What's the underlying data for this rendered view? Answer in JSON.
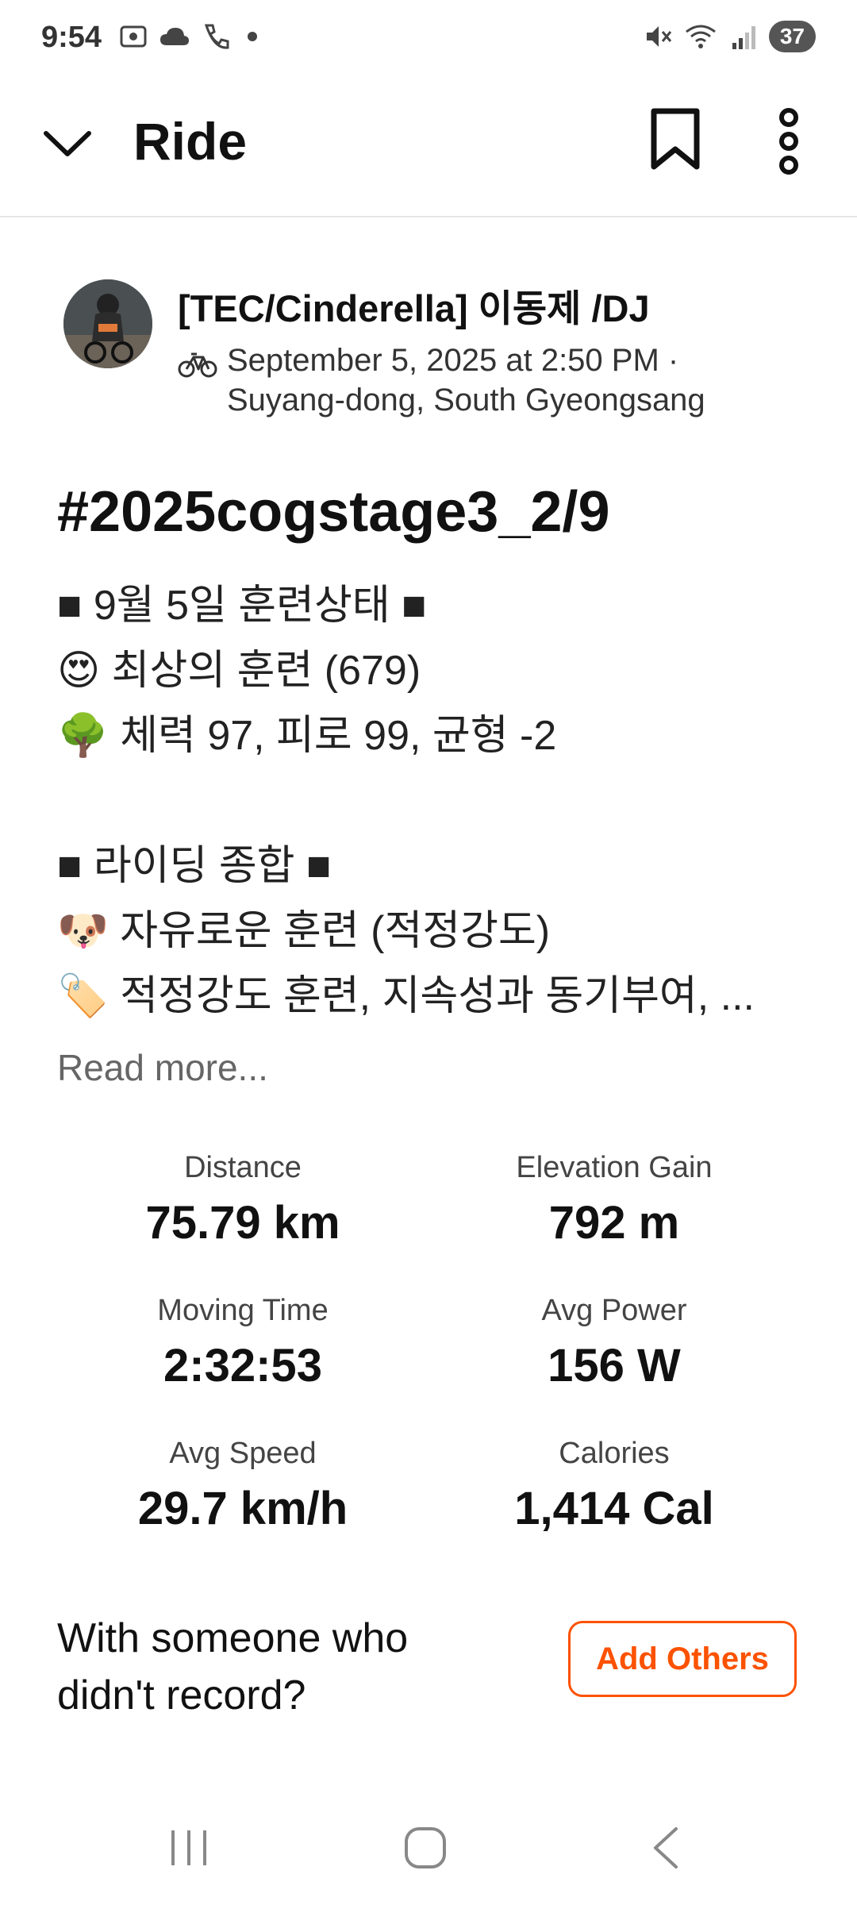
{
  "status_bar": {
    "time": "9:54",
    "battery": "37"
  },
  "header": {
    "title": "Ride"
  },
  "author": {
    "name": "[TEC/Cinderella] 이동제 /DJ",
    "date": "September 5, 2025 at 2:50 PM ·",
    "location": "Suyang-dong, South Gyeongsang"
  },
  "activity": {
    "title": "#2025cogstage3_2/9",
    "description": [
      "■ 9월 5일 훈련상태 ■",
      "😍 최상의 훈련 (679)",
      "🌳 체력 97, 피로 99, 균형 -2",
      "",
      "■ 라이딩 종합 ■",
      "🐶 자유로운 훈련 (적정강도)",
      "🏷️ 적정강도 훈련, 지속성과 동기부여, ..."
    ],
    "read_more": "Read more..."
  },
  "stats": [
    {
      "label": "Distance",
      "value": "75.79 km"
    },
    {
      "label": "Elevation Gain",
      "value": "792 m"
    },
    {
      "label": "Moving Time",
      "value": "2:32:53"
    },
    {
      "label": "Avg Power",
      "value": "156 W"
    },
    {
      "label": "Avg Speed",
      "value": "29.7 km/h"
    },
    {
      "label": "Calories",
      "value": "1,414 Cal"
    }
  ],
  "prompt": {
    "line1": "With someone who",
    "line2": "didn't record?",
    "button": "Add Others"
  },
  "colors": {
    "accent": "#fc5200"
  }
}
